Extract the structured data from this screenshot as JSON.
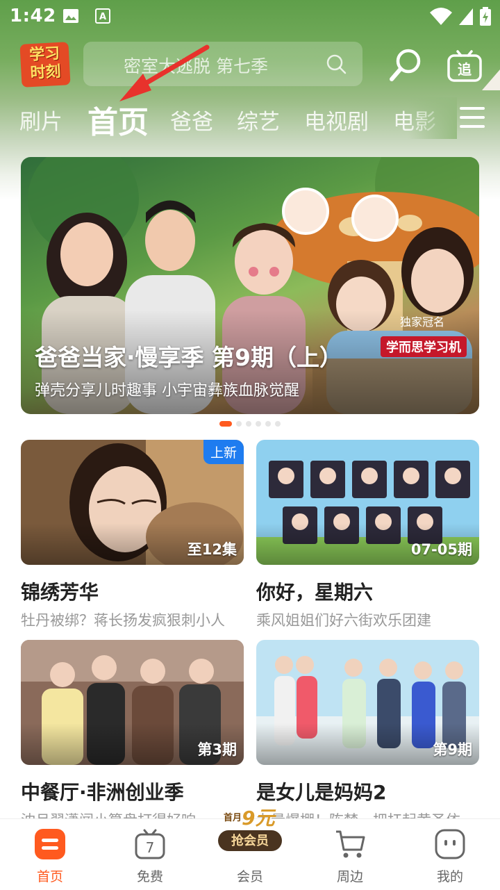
{
  "status_bar": {
    "time": "1:42"
  },
  "header": {
    "logo_text_line1": "学习",
    "logo_text_line2": "时刻",
    "search_placeholder": "密室大逃脱 第七季"
  },
  "tabs": [
    {
      "label": "刷片"
    },
    {
      "label": "首页"
    },
    {
      "label": "爸爸"
    },
    {
      "label": "综艺"
    },
    {
      "label": "电视剧"
    },
    {
      "label": "电影"
    }
  ],
  "banner": {
    "title": "爸爸当家·慢享季 第9期（上）",
    "subtitle": "弹壳分享儿时趣事 小宇宙彝族血脉觉醒",
    "sponsor_label": "独家冠名",
    "sponsor": "学而思学习机",
    "carousel_index": 1,
    "carousel_count": 6
  },
  "cards": [
    {
      "title": "锦绣芳华",
      "desc": "牡丹被绑？蒋长扬发疯狠刺小人",
      "badge": "上新",
      "episode": "至12集"
    },
    {
      "title": "你好，星期六",
      "desc": "乘风姐姐们好六街欢乐团建",
      "episode": "07-05期"
    },
    {
      "title": "中餐厅·非洲创业季",
      "desc": "沈月翟潇闻小算盘打得好响",
      "episode": "第3期"
    },
    {
      "title": "是女儿是妈妈2",
      "desc": "力量爆棚！陈梦一把扛起黄圣依",
      "episode": "第9期"
    }
  ],
  "bottom_nav": [
    {
      "label": "首页"
    },
    {
      "label": "免费"
    },
    {
      "label": "会员"
    },
    {
      "label": "周边"
    },
    {
      "label": "我的"
    }
  ],
  "vip_promo": {
    "line1": "首月",
    "price": "9元",
    "button": "抢会员"
  },
  "colors": {
    "accent": "#ff5a1f",
    "header_green": "#6ea659",
    "badge_blue": "#1e7cf0"
  }
}
